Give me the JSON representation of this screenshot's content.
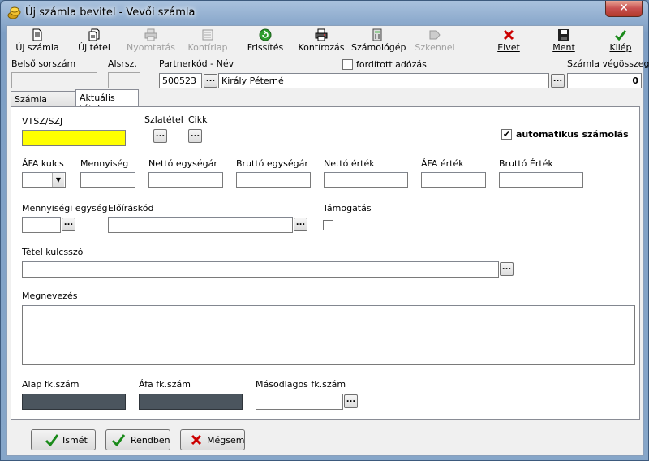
{
  "window": {
    "title": "Új számla bevitel - Vevői számla",
    "close": "✕"
  },
  "toolbar": [
    {
      "id": "uj-szamla",
      "label": "Új számla",
      "icon": "new-invoice-icon",
      "enabled": true
    },
    {
      "id": "uj-tetel",
      "label": "Új tétel",
      "icon": "new-item-icon",
      "enabled": true
    },
    {
      "id": "nyomtatas",
      "label": "Nyomtatás",
      "icon": "print-icon",
      "enabled": false
    },
    {
      "id": "kontirlap",
      "label": "Kontírlap",
      "icon": "ledger-sheet-icon",
      "enabled": false
    },
    {
      "id": "frissites",
      "label": "Frissítés",
      "icon": "refresh-icon",
      "enabled": true
    },
    {
      "id": "kontirozas",
      "label": "Kontírozás",
      "icon": "accounting-icon",
      "enabled": true
    },
    {
      "id": "szamologep",
      "label": "Számológép",
      "icon": "calculator-icon",
      "enabled": true
    },
    {
      "id": "szkennel",
      "label": "Szkennel",
      "icon": "scan-icon",
      "enabled": false
    },
    {
      "id": "elvet",
      "label": "Elvet",
      "icon": "discard-icon",
      "enabled": true
    },
    {
      "id": "ment",
      "label": "Ment",
      "icon": "save-icon",
      "enabled": true
    },
    {
      "id": "kilep",
      "label": "Kilép",
      "icon": "exit-check-icon",
      "enabled": true
    }
  ],
  "header": {
    "belso_sorszam_label": "Belső sorszám",
    "belso_sorszam_value": "",
    "alsrsz_label": "Alsrsz.",
    "alsrsz_value": "",
    "partner_label": "Partnerkód - Név",
    "partner_code": "500523",
    "partner_name": "Király Péterné",
    "forditott_label": "fordított adózás",
    "forditott_checked": false,
    "vegosszeg_label": "Számla végösszege",
    "vegosszeg_value": "0"
  },
  "tabs": [
    {
      "label": "Számla adatok",
      "active": false
    },
    {
      "label": "Aktuális tétel",
      "active": true
    }
  ],
  "item": {
    "vtsz_label": "VTSZ/SZJ",
    "vtsz_value": "",
    "szlatetel_label": "Szlatétel",
    "cikk_label": "Cikk",
    "auto_label": "automatikus számolás",
    "auto_checked": true,
    "check_mark": "✔",
    "afa_kulcs_label": "ÁFA kulcs",
    "afa_kulcs_value": "",
    "mennyiseg_label": "Mennyiség",
    "mennyiseg_value": "",
    "netto_egysegar_label": "Nettó egységár",
    "netto_egysegar_value": "",
    "brutto_egysegar_label": "Bruttó egységár",
    "brutto_egysegar_value": "",
    "netto_ertek_label": "Nettó érték",
    "netto_ertek_value": "",
    "afa_ertek_label": "ÁFA érték",
    "afa_ertek_value": "",
    "brutto_ertek_label": "Bruttó Érték",
    "brutto_ertek_value": "",
    "mennyisegi_egyseg_label": "Mennyiségi egység",
    "mennyisegi_egyseg_value": "",
    "eloiraskod_label": "Előíráskód",
    "eloiraskod_value": "",
    "tamogatas_label": "Támogatás",
    "tamogatas_checked": false,
    "tetel_kulcsszo_label": "Tétel kulcsszó",
    "tetel_kulcsszo_value": "",
    "megnevezes_label": "Megnevezés",
    "megnevezes_value": "",
    "alap_fk_label": "Alap fk.szám",
    "afa_fk_label": "Áfa fk.szám",
    "masodlagos_fk_label": "Másodlagos fk.szám",
    "ellipsis": "...",
    "combo_arrow": "▼"
  },
  "buttons": {
    "ismet": "Ismét",
    "rendben": "Rendben",
    "megsem": "Mégsem"
  }
}
